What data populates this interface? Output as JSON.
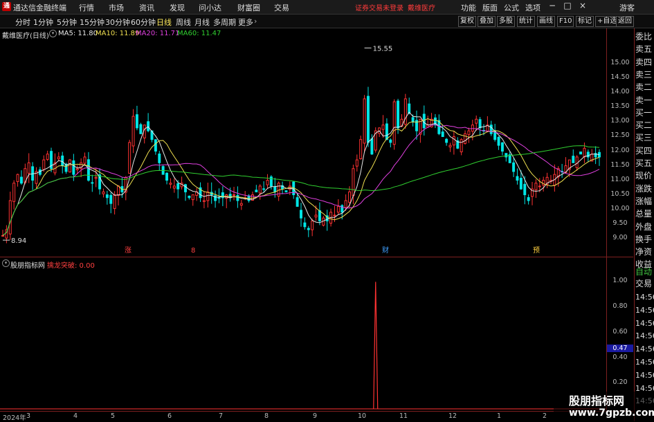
{
  "titlebar": {
    "app_name": "通达信金融终端",
    "menus": [
      "行情",
      "市场",
      "资讯",
      "发现",
      "问小达",
      "财富圈",
      "交易"
    ],
    "alert": "证券交易未登录",
    "stock_link": "戴维医疗",
    "right_menus": [
      "功能",
      "版面",
      "公式",
      "选项"
    ],
    "guest": "游客"
  },
  "toolbar": {
    "timeframes": [
      "分时",
      "1分钟",
      "5分钟",
      "15分钟",
      "30分钟",
      "60分钟",
      "日线",
      "周线",
      "月线",
      "多周期",
      "更多"
    ],
    "active_timeframe": "日线",
    "right_buttons": [
      "复权",
      "叠加",
      "多股",
      "统计",
      "画线",
      "F10",
      "标记",
      "+自选",
      "返回"
    ]
  },
  "main_chart": {
    "stock_title": "戴维医疗(日线)",
    "ma_legend": [
      {
        "label": "MA5: 11.80",
        "color": "#e8e8e8"
      },
      {
        "label": "MA10: 11.89",
        "color": "#f0e050"
      },
      {
        "label": "MA20: 11.71",
        "color": "#e040e0"
      },
      {
        "label": "MA60: 11.47",
        "color": "#30d030"
      }
    ],
    "high_label": "15.55",
    "low_label": "8.94",
    "y_ticks": [
      "15.00",
      "14.50",
      "14.00",
      "13.50",
      "13.00",
      "12.50",
      "12.00",
      "11.50",
      "11.00",
      "10.50",
      "10.00",
      "9.50",
      "9.00"
    ],
    "markers": [
      {
        "text": "涨",
        "color": "#ff4040"
      },
      {
        "text": "8",
        "color": "#ff4040"
      },
      {
        "text": "财",
        "color": "#40a0ff"
      },
      {
        "text": "预",
        "color": "#ffd040"
      }
    ]
  },
  "indicator": {
    "name": "股朋指标网",
    "signal_label": "擒龙突破: 0.00",
    "y_ticks": [
      "1.00",
      "0.80",
      "0.60",
      "0.47",
      "0.40",
      "0.20"
    ],
    "current_value": "0.47"
  },
  "x_axis": {
    "labels": [
      "2024年",
      "3",
      "4",
      "5",
      "6",
      "7",
      "8",
      "9",
      "10",
      "11",
      "12",
      "1",
      "2"
    ]
  },
  "right_panel": {
    "quote_labels": [
      "委比",
      "卖五",
      "卖四",
      "卖三",
      "卖二",
      "卖一",
      "买一",
      "买二",
      "买三",
      "买四",
      "买五",
      "现价",
      "涨跌",
      "涨幅",
      "总量",
      "外盘",
      "换手",
      "净资",
      "收益"
    ],
    "auto_label": "自动",
    "trade_label": "交易",
    "times": [
      "14:56",
      "14:56",
      "14:56",
      "14:56",
      "14:56",
      "14:56",
      "14:56",
      "14:56",
      "14:56"
    ]
  },
  "watermark": {
    "line1": "股朋指标网",
    "line2": "www.7gpzb.com"
  },
  "chart_data": {
    "type": "candlestick",
    "ylim": [
      8.8,
      15.7
    ],
    "close_series": [
      9.1,
      9.3,
      10.3,
      10.9,
      11.2,
      10.9,
      11.4,
      11.6,
      11.0,
      11.3,
      11.2,
      11.7,
      11.9,
      11.4,
      11.6,
      11.8,
      11.5,
      11.3,
      11.7,
      11.2,
      11.4,
      11.6,
      11.8,
      11.0,
      10.9,
      11.1,
      10.7,
      10.6,
      10.4,
      10.2,
      10.5,
      10.8,
      10.6,
      11.1,
      12.3,
      13.2,
      12.8,
      12.6,
      12.9,
      12.7,
      12.4,
      12.0,
      11.6,
      11.2,
      11.0,
      10.9,
      10.8,
      10.7,
      10.9,
      10.6,
      10.4,
      10.5,
      10.6,
      10.4,
      10.3,
      10.6,
      10.5,
      10.3,
      10.4,
      10.4,
      10.5,
      10.4,
      10.5,
      10.3,
      10.2,
      10.4,
      10.3,
      10.5,
      10.6,
      10.8,
      10.7,
      11.0,
      10.8,
      10.6,
      10.9,
      10.7,
      10.6,
      10.8,
      10.5,
      10.1,
      9.7,
      9.4,
      9.3,
      9.6,
      9.8,
      9.6,
      9.7,
      9.6,
      9.9,
      9.8,
      10.1,
      9.9,
      10.3,
      10.6,
      11.4,
      11.7,
      12.4,
      13.8,
      12.3,
      11.9,
      12.7,
      12.8,
      12.9,
      12.4,
      12.3,
      13.7,
      12.8,
      13.1,
      13.8,
      13.3,
      13.0,
      12.7,
      13.1,
      12.8,
      12.9,
      13.1,
      12.9,
      12.6,
      12.5,
      12.3,
      12.2,
      12.5,
      12.1,
      12.4,
      12.6,
      12.7,
      12.9,
      13.1,
      12.8,
      12.7,
      12.9,
      12.6,
      12.4,
      12.2,
      12.0,
      11.8,
      11.6,
      11.3,
      11.0,
      10.7,
      10.5,
      10.3,
      10.7,
      10.9,
      10.8,
      11.0,
      11.1,
      11.0,
      11.2,
      11.4,
      11.3,
      11.5,
      11.7,
      11.6,
      11.8,
      11.9,
      12.1,
      11.8,
      11.9,
      11.8,
      11.8
    ],
    "ma5_last": 11.8,
    "ma10_last": 11.89,
    "ma20_last": 11.71,
    "ma60_last": 11.47,
    "max_price": 15.55,
    "min_price": 8.94,
    "indicator_signal_index": 100,
    "indicator_signal_value": 1.0,
    "indicator_ylim": [
      0,
      1.1
    ]
  }
}
